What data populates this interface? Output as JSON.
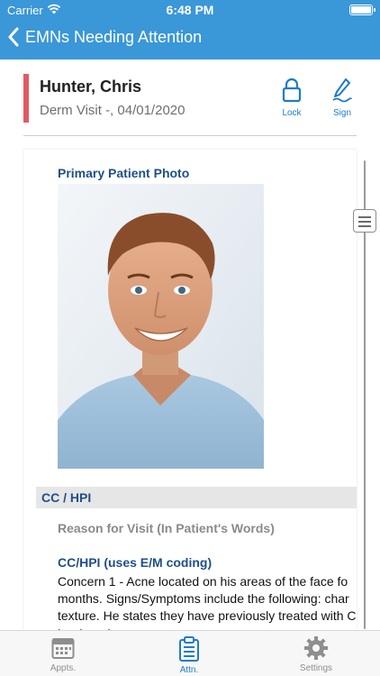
{
  "status_bar": {
    "carrier": "Carrier",
    "time": "6:48 PM"
  },
  "nav": {
    "back_label": "EMNs Needing Attention"
  },
  "patient": {
    "name": "Hunter, Chris",
    "visit": "Derm Visit -, 04/01/2020",
    "actions": [
      {
        "label": "Lock",
        "icon": "lock-icon"
      },
      {
        "label": "Sign",
        "icon": "pen-icon"
      }
    ]
  },
  "document": {
    "photo_title": "Primary Patient Photo",
    "section_title": "CC / HPI",
    "reason_label": "Reason for Visit (In Patient's Words)",
    "cchpi_title": "CC/HPI (uses E/M coding)",
    "cchpi_lines": [
      "Concern 1 - Acne located on his areas of the face fo",
      "months. Signs/Symptoms include the following: char",
      "texture. He states they have previously treated with C",
      "treatment"
    ]
  },
  "tabs": [
    {
      "label": "Appts.",
      "icon": "calendar-icon",
      "active": false
    },
    {
      "label": "Attn.",
      "icon": "clipboard-icon",
      "active": true
    },
    {
      "label": "Settings",
      "icon": "gear-icon",
      "active": false
    }
  ],
  "colors": {
    "accent": "#3a97d8",
    "link": "#1e7bc8",
    "flag": "#e25a66",
    "heading": "#1f4f8a"
  }
}
